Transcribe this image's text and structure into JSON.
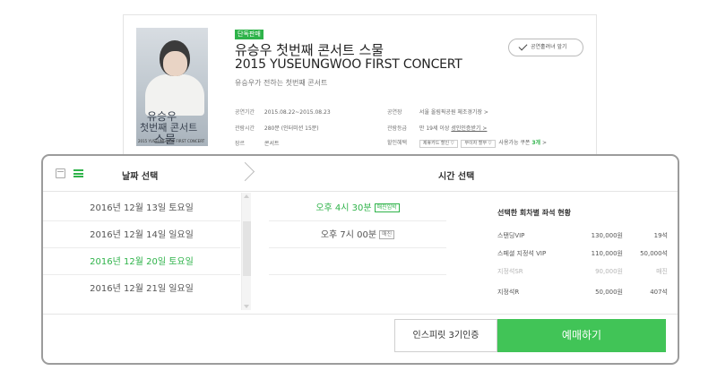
{
  "product": {
    "badge": "단독판매",
    "title_kr": "유승우 첫번째 콘서트 스물",
    "title_en": "2015 YUSEUNGWOO FIRST CONCERT",
    "subtitle": "유승우가 전하는 첫번째 콘서트",
    "notify_label": "공연홀려녀 앞기",
    "poster": {
      "title_line1": "유승우",
      "title_line2": "첫번째 콘서트",
      "title_line3": "스물",
      "caption": "2015 YUSEUNGWOO FIRST CONCERT"
    },
    "info_left": [
      {
        "key": "공연기간",
        "value": "2015.08.22~2015.08.23"
      },
      {
        "key": "관람시간",
        "value": "280분 (인터미션 15분)"
      },
      {
        "key": "장르",
        "value": "콘서트"
      }
    ],
    "venue": {
      "key": "공연장",
      "value": "서울 올림픽공원 체조경기장 >"
    },
    "rating": {
      "key": "관람등급",
      "value": "만 19세 이상",
      "link": "셩인인증받기 >"
    },
    "discount": {
      "key": "할인혜택",
      "select1": "제휴카드 할인 ▽",
      "select2": "무이자 할부 ▽",
      "coupon_prefix": "사용가능 쿠폰",
      "coupon_count": "3개",
      "coupon_suffix": ">"
    }
  },
  "booking": {
    "date_header": "날짜 선택",
    "time_header": "시간 선택",
    "dates": [
      {
        "label": "2016년 12월 13일 토요일",
        "selected": false
      },
      {
        "label": "2016년 12월 14일 일요일",
        "selected": false
      },
      {
        "label": "2016년 12월 20일 토요일",
        "selected": true
      },
      {
        "label": "2016년 12월 21일 일요일",
        "selected": false
      }
    ],
    "times": [
      {
        "label": "오후 4시 30분",
        "tag": "매진임박",
        "selected": true
      },
      {
        "label": "오후 7시 00분",
        "tag": "매진",
        "selected": false
      }
    ],
    "seat_status": {
      "title": "선택한 회차별 좌석 현황",
      "rows": [
        {
          "name": "스탠딩VIP",
          "price": "130,000원",
          "count": "19석",
          "soldout": false
        },
        {
          "name": "스페셜 지정석 VIP",
          "price": "110,000원",
          "count": "50,000석",
          "soldout": false
        },
        {
          "name": "지정석SR",
          "price": "90,000원",
          "count": "매진",
          "soldout": true
        },
        {
          "name": "지정석R",
          "price": "50,000원",
          "count": "407석",
          "soldout": false
        }
      ]
    },
    "inspirit_button": "인스피릿 3기인증",
    "book_button": "예매하기"
  },
  "colors": {
    "accent": "#2fb34a",
    "book_button": "#41c457"
  }
}
